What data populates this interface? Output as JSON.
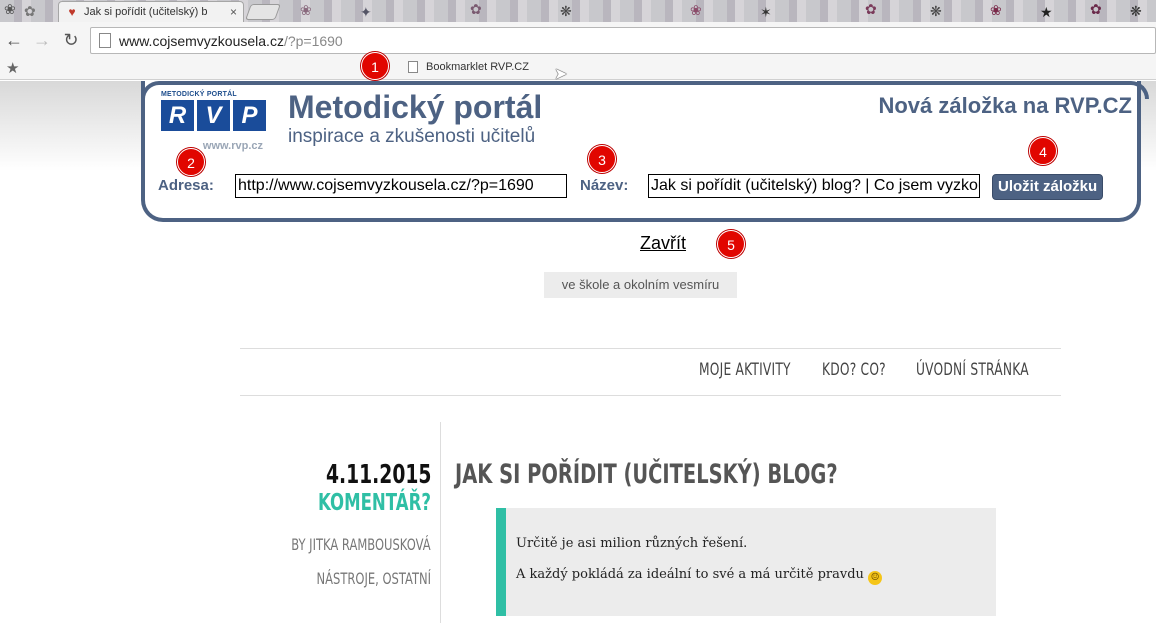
{
  "browser": {
    "tab_title": "Jak si pořídit (učitelský) b",
    "url_main": "www.cojsemvyzkousela.cz",
    "url_rest": "/?p=1690",
    "bookmark_label": "Bookmarklet RVP.CZ",
    "back_icon": "←",
    "forward_icon": "→",
    "reload_icon": "↻",
    "close_tab_icon": "×",
    "star_icon": "★"
  },
  "markers": [
    "1",
    "2",
    "3",
    "4",
    "5"
  ],
  "rvp": {
    "logo_small": "METODICKÝ PORTÁL",
    "logo_letters": [
      "R",
      "V",
      "P"
    ],
    "logo_url": "www.rvp.cz",
    "title": "Metodický portál",
    "subtitle": "inspirace a zkušenosti učitelů",
    "heading": "Nová záložka na RVP.CZ",
    "address_label": "Adresa:",
    "address_value": "http://www.cojsemvyzkousela.cz/?p=1690",
    "name_label": "Název:",
    "name_value": "Jak si pořídit (učitelský) blog? | Co jsem vyzkoušela",
    "save_label": "Uložit záložku",
    "close_label": "Zavřít"
  },
  "blog": {
    "tagline": "ve škole a okolním vesmíru",
    "nav": [
      "MOJE AKTIVITY",
      "KDO? CO?",
      "ÚVODNÍ STRÁNKA"
    ],
    "post": {
      "date": "4.11.2015",
      "comment_label": "KOMENTÁŘ?",
      "author": "BY JITKA RAMBOUSKOVÁ",
      "categories": "NÁSTROJE, OSTATNÍ",
      "title": "JAK SI POŘÍDIT (UČITELSKÝ) BLOG?",
      "quote_lines": [
        "Určitě je asi milion různých řešení.",
        "A každý pokládá za ideální to své a má určitě pravdu"
      ],
      "smiley": "🙂"
    }
  },
  "colors": {
    "rvp_blue": "#4d6283",
    "accent_teal": "#2fbfa5",
    "marker_red": "#e10600"
  }
}
